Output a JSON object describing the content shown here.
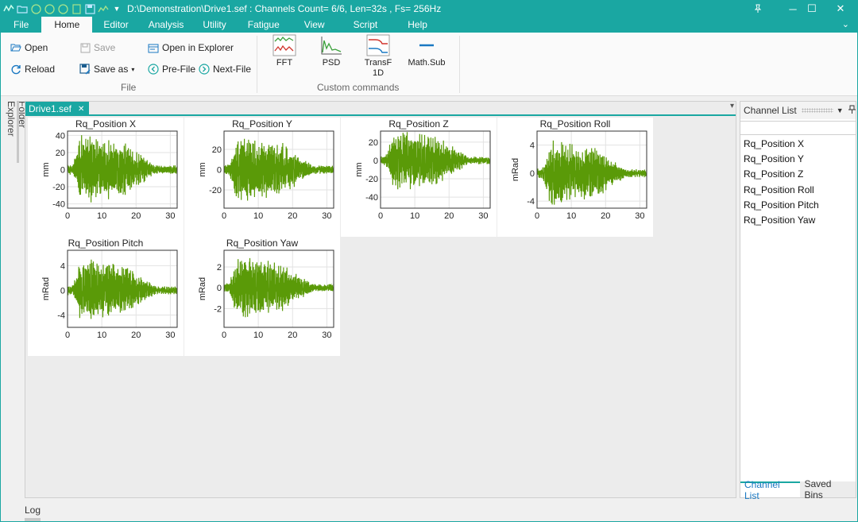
{
  "titlebar": {
    "title": "D:\\Demonstration\\Drive1.sef : Channels Count= 6/6, Len=32s , Fs= 256Hz",
    "pin": "⚲",
    "minimize": "─",
    "maximize": "☐",
    "close": "✕"
  },
  "menu": {
    "items": [
      "File",
      "Home",
      "Editor",
      "Analysis",
      "Utility",
      "Fatigue",
      "View",
      "Script",
      "Help"
    ],
    "active": "Home"
  },
  "ribbon": {
    "file_group": {
      "open": "Open",
      "reload": "Reload",
      "save": "Save",
      "save_as": "Save as",
      "open_in_explorer": "Open in Explorer",
      "pre_file": "Pre-File",
      "next_file": "Next-File",
      "label": "File"
    },
    "custom_group": {
      "fft": "FFT",
      "psd": "PSD",
      "transf_1": "TransF",
      "transf_2": "1D",
      "mathsub": "Math.Sub",
      "label": "Custom commands"
    }
  },
  "sidebar": {
    "folder_explorer": "Folder Explorer"
  },
  "document": {
    "tab": "Drive1.sef",
    "tab_close": "✕"
  },
  "charts": [
    {
      "title": "Rq_Position X",
      "ylabel": "mm",
      "yticks": [
        "40",
        "20",
        "0",
        "-20",
        "-40"
      ],
      "xticks": [
        "0",
        "10",
        "20",
        "30"
      ]
    },
    {
      "title": "Rq_Position Y",
      "ylabel": "mm",
      "yticks": [
        "20",
        "0",
        "-20"
      ],
      "xticks": [
        "0",
        "10",
        "20",
        "30"
      ]
    },
    {
      "title": "Rq_Position Z",
      "ylabel": "mm",
      "yticks": [
        "20",
        "0",
        "-20",
        "-40"
      ],
      "xticks": [
        "0",
        "10",
        "20",
        "30"
      ]
    },
    {
      "title": "Rq_Position Roll",
      "ylabel": "mRad",
      "yticks": [
        "4",
        "0",
        "-4"
      ],
      "xticks": [
        "0",
        "10",
        "20",
        "30"
      ]
    },
    {
      "title": "Rq_Position Pitch",
      "ylabel": "mRad",
      "yticks": [
        "4",
        "0",
        "-4"
      ],
      "xticks": [
        "0",
        "10",
        "20",
        "30"
      ]
    },
    {
      "title": "Rq_Position Yaw",
      "ylabel": "mRad",
      "yticks": [
        "2",
        "0",
        "-2"
      ],
      "xticks": [
        "0",
        "10",
        "20",
        "30"
      ]
    }
  ],
  "chart_data": [
    {
      "type": "line",
      "title": "Rq_Position X",
      "xlim": [
        0,
        32
      ],
      "ylim": [
        -45,
        45
      ],
      "ylabel": "mm",
      "color": "#5a9a08",
      "envelope_peak": 42
    },
    {
      "type": "line",
      "title": "Rq_Position Y",
      "xlim": [
        0,
        32
      ],
      "ylim": [
        -38,
        38
      ],
      "ylabel": "mm",
      "color": "#5a9a08",
      "envelope_peak": 36
    },
    {
      "type": "line",
      "title": "Rq_Position Z",
      "xlim": [
        0,
        32
      ],
      "ylim": [
        -52,
        32
      ],
      "ylabel": "mm",
      "color": "#5a9a08",
      "envelope_peak": 35
    },
    {
      "type": "line",
      "title": "Rq_Position Roll",
      "xlim": [
        0,
        32
      ],
      "ylim": [
        -5,
        6
      ],
      "ylabel": "mRad",
      "color": "#5a9a08",
      "envelope_peak": 5
    },
    {
      "type": "line",
      "title": "Rq_Position Pitch",
      "xlim": [
        0,
        32
      ],
      "ylim": [
        -6,
        6.5
      ],
      "ylabel": "mRad",
      "color": "#5a9a08",
      "envelope_peak": 5.5
    },
    {
      "type": "line",
      "title": "Rq_Position Yaw",
      "xlim": [
        0,
        32
      ],
      "ylim": [
        -3.8,
        3.6
      ],
      "ylabel": "mRad",
      "color": "#5a9a08",
      "envelope_peak": 3.2
    }
  ],
  "channel_panel": {
    "title": "Channel List",
    "channels": [
      "Rq_Position X",
      "Rq_Position Y",
      "Rq_Position Z",
      "Rq_Position Roll",
      "Rq_Position Pitch",
      "Rq_Position Yaw"
    ],
    "tabs": [
      "Channel List",
      "Saved Bins"
    ]
  },
  "log": {
    "label": "Log"
  },
  "colors": {
    "accent": "#1aa7a2",
    "signal": "#5a9a08"
  }
}
